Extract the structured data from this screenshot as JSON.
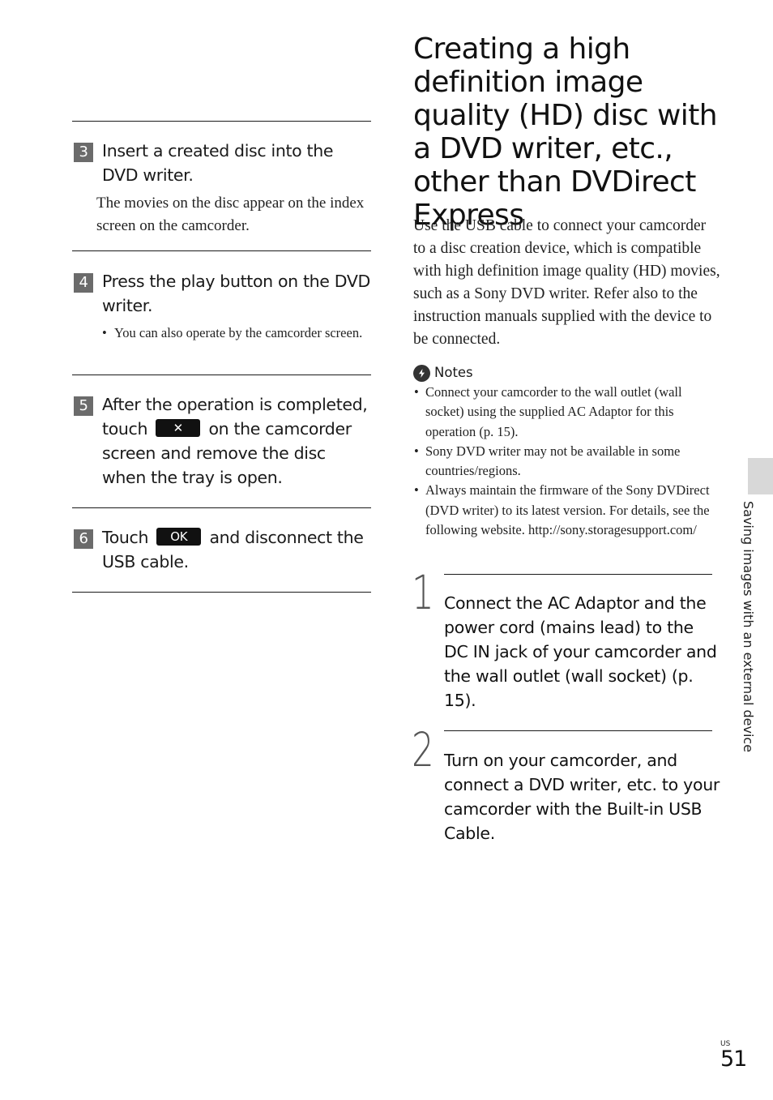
{
  "left_column": {
    "steps": [
      {
        "number": "3",
        "text": "Insert a created disc into the DVD writer.",
        "body": "The movies on the disc appear on the index screen on the camcorder."
      },
      {
        "number": "4",
        "text": "Press the play button on the DVD writer.",
        "bullets": [
          "You can also operate by the camcorder screen."
        ]
      },
      {
        "number": "5",
        "text_before": "After the operation is completed, touch",
        "button_label": "✕",
        "button_icon": "close-icon",
        "text_after": "on the camcorder screen and remove the disc when the tray is open."
      },
      {
        "number": "6",
        "text_before": "Touch",
        "button_label": "OK",
        "text_after": "and disconnect the USB cable."
      }
    ]
  },
  "right_column": {
    "title": "Creating a high definition image quality (HD) disc with a DVD writer, etc., other than DVDirect Express",
    "intro": "Use the USB cable to connect your camcorder to a disc creation device, which is compatible with high definition image quality (HD) movies, such as a Sony DVD writer. Refer also to the instruction manuals supplied with the device to be connected.",
    "notes": {
      "icon": "notes-warning-icon",
      "heading": "Notes",
      "items": [
        "Connect your camcorder to the wall outlet (wall socket) using the supplied AC Adaptor for this operation (p. 15).",
        "Sony DVD writer may not be available in some countries/regions.",
        "Always maintain the firmware of the Sony DVDirect (DVD writer) to its latest version. For details, see the following website. http://sony.storagesupport.com/"
      ]
    },
    "big_steps": [
      {
        "number": "1",
        "text": "Connect the AC Adaptor and the power cord (mains lead) to the DC IN jack of your camcorder and the wall outlet (wall socket) (p. 15)."
      },
      {
        "number": "2",
        "text": "Turn on your camcorder, and connect a DVD writer, etc. to your camcorder with the Built-in USB Cable."
      }
    ]
  },
  "side_tab": {
    "label": "Saving images with an external device"
  },
  "footer": {
    "region": "US",
    "page_number": "51"
  }
}
